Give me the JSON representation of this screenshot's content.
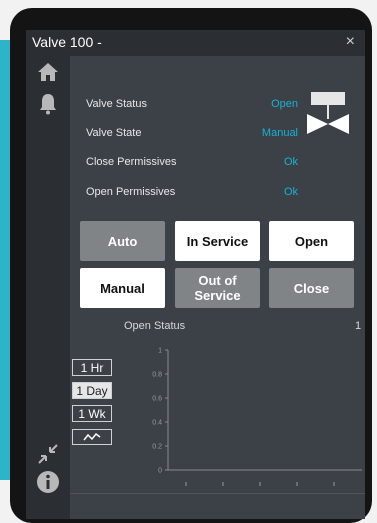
{
  "dialog": {
    "title": "Valve 100 -",
    "close_glyph": "×"
  },
  "sidebar": {
    "icons": [
      "home-icon",
      "bell-icon",
      "collapse-arrows-icon",
      "info-icon"
    ]
  },
  "status": {
    "rows": [
      {
        "label": "Valve Status",
        "value": "Open"
      },
      {
        "label": "Valve State",
        "value": "Manual"
      },
      {
        "label": "Close Permissives",
        "value": "Ok"
      },
      {
        "label": "Open Permissives",
        "value": "Ok"
      }
    ]
  },
  "buttons": {
    "auto": "Auto",
    "in_service": "In Service",
    "open": "Open",
    "manual": "Manual",
    "out_of_service": "Out of Service",
    "close": "Close"
  },
  "chart": {
    "title": "Open Status",
    "corner_label": "1",
    "ranges": [
      "1 Hr",
      "1 Day",
      "1 Wk"
    ],
    "selected_range": "1 Day",
    "trend_icon": "trend-icon"
  },
  "chart_data": {
    "type": "line",
    "title": "Open Status",
    "yticks": [
      "1",
      "0.8",
      "0.6",
      "0.4",
      "0.2",
      "0"
    ],
    "ylim": [
      0,
      1
    ],
    "series": [],
    "grid": false
  },
  "colors": {
    "accent": "#17b3d6",
    "panel": "#3c4047",
    "titlebar": "#2b2e33",
    "button_grey": "#808487",
    "button_white": "#ffffff"
  }
}
